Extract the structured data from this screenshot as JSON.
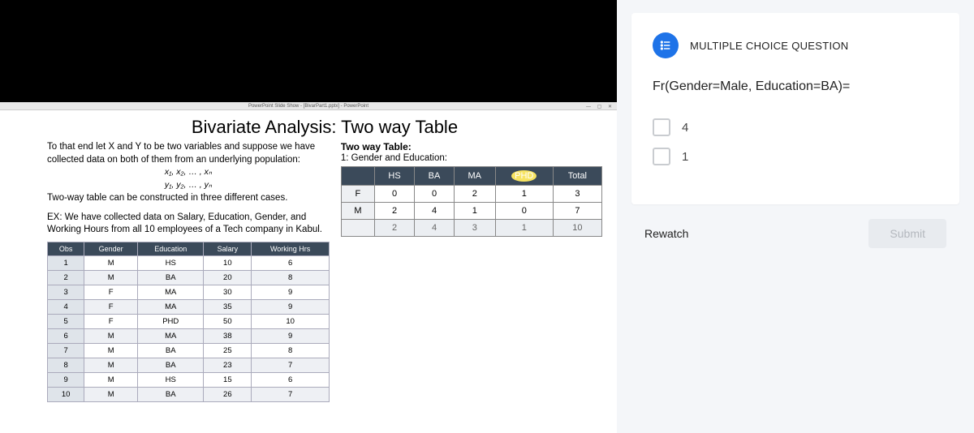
{
  "window_title": "PowerPoint Slide Show - [BivarPart1.pptx] - PowerPoint",
  "slide": {
    "title": "Bivariate Analysis: Two way Table",
    "p1": "To that end let X and Y to be two variables and suppose we have collected data on both of them from an underlying population:",
    "vars1": "x₁, x₂, … , xₙ",
    "vars2": "y₁, y₂, … , yₙ",
    "p2": "Two-way table can be constructed in three different cases.",
    "ex": "EX: We have collected data on Salary, Education, Gender, and Working Hours from all 10 employees of a Tech company in Kabul.",
    "right_head": "Two way Table:",
    "right_sub": "1: Gender and Education:"
  },
  "two_way": {
    "cols": [
      "",
      "HS",
      "BA",
      "MA",
      "PHD",
      "Total"
    ],
    "rows": [
      [
        "F",
        "0",
        "0",
        "2",
        "1",
        "3"
      ],
      [
        "M",
        "2",
        "4",
        "1",
        "0",
        "7"
      ],
      [
        "",
        "2",
        "4",
        "3",
        "1",
        "10"
      ]
    ]
  },
  "data_table": {
    "cols": [
      "Obs",
      "Gender",
      "Education",
      "Salary",
      "Working Hrs"
    ],
    "rows": [
      [
        "1",
        "M",
        "HS",
        "10",
        "6"
      ],
      [
        "2",
        "M",
        "BA",
        "20",
        "8"
      ],
      [
        "3",
        "F",
        "MA",
        "30",
        "9"
      ],
      [
        "4",
        "F",
        "MA",
        "35",
        "9"
      ],
      [
        "5",
        "F",
        "PHD",
        "50",
        "10"
      ],
      [
        "6",
        "M",
        "MA",
        "38",
        "9"
      ],
      [
        "7",
        "M",
        "BA",
        "25",
        "8"
      ],
      [
        "8",
        "M",
        "BA",
        "23",
        "7"
      ],
      [
        "9",
        "M",
        "HS",
        "15",
        "6"
      ],
      [
        "10",
        "M",
        "BA",
        "26",
        "7"
      ]
    ]
  },
  "question": {
    "type_label": "MULTIPLE CHOICE QUESTION",
    "text": "Fr(Gender=Male, Education=BA)=",
    "options": [
      "4",
      "1"
    ],
    "rewatch": "Rewatch",
    "submit": "Submit"
  }
}
